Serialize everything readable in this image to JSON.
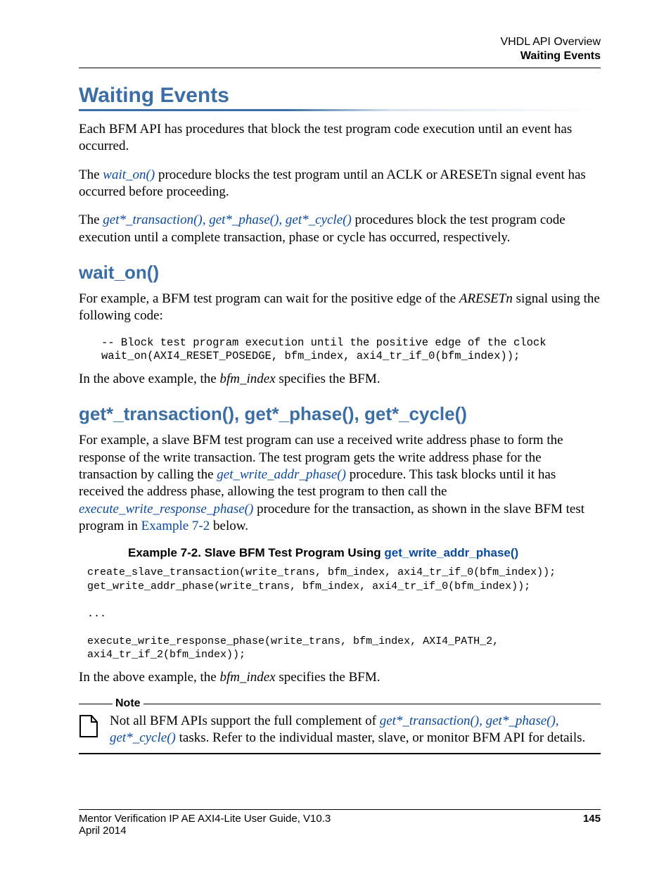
{
  "header": {
    "line1": "VHDL API Overview",
    "line2": "Waiting Events"
  },
  "h1": "Waiting Events",
  "para1": "Each BFM API has procedures that block the test program code execution until an event has occurred.",
  "para2_pre": "The ",
  "para2_link": "wait_on()",
  "para2_post": " procedure blocks the test program until an ACLK or ARESETn signal event has occurred before proceeding.",
  "para3_pre": "The ",
  "para3_link": "get*_transaction(), get*_phase(), get*_cycle()",
  "para3_post": " procedures block the test program code execution until a complete transaction, phase or cycle has occurred, respectively.",
  "h2a": "wait_on()",
  "para4_pre": "For example, a BFM test program can wait for the positive edge of the ",
  "para4_em": "ARESETn",
  "para4_post": " signal using the following code:",
  "code1": "-- Block test program execution until the positive edge of the clock\nwait_on(AXI4_RESET_POSEDGE, bfm_index, axi4_tr_if_0(bfm_index));",
  "para5_pre": "In the above example, the ",
  "para5_em": "bfm_index",
  "para5_post": " specifies the BFM.",
  "h2b": "get*_transaction(), get*_phase(), get*_cycle()",
  "para6_a": "For example, a slave BFM test program can use a received write address phase to form the response of the write transaction. The test program gets the write address phase for the transaction by calling the ",
  "para6_link1": "get_write_addr_phase()",
  "para6_b": " procedure. This task blocks until it has received the address phase, allowing the test program to then call the ",
  "para6_link2": "execute_write_response_phase()",
  "para6_c": " procedure for the transaction, as shown in the slave BFM test program in ",
  "para6_link3": "Example 7-2",
  "para6_d": " below.",
  "example_title_pre": "Example 7-2. Slave BFM Test Program Using ",
  "example_title_link": "get_write_addr_phase()",
  "code2": "create_slave_transaction(write_trans, bfm_index, axi4_tr_if_0(bfm_index));\nget_write_addr_phase(write_trans, bfm_index, axi4_tr_if_0(bfm_index));\n\n...\n\nexecute_write_response_phase(write_trans, bfm_index, AXI4_PATH_2,\naxi4_tr_if_2(bfm_index));",
  "para7_pre": "In the above example, the ",
  "para7_em": "bfm_index",
  "para7_post": " specifies the BFM.",
  "note": {
    "label": "Note",
    "text_a": "Not all BFM APIs support the full complement of ",
    "link": "get*_transaction(), get*_phase(), get*_cycle()",
    "text_b": " tasks. Refer to the individual master, slave, or monitor BFM API for details."
  },
  "footer": {
    "title": "Mentor Verification IP AE AXI4-Lite User Guide, V10.3",
    "date": "April 2014",
    "page": "145"
  }
}
